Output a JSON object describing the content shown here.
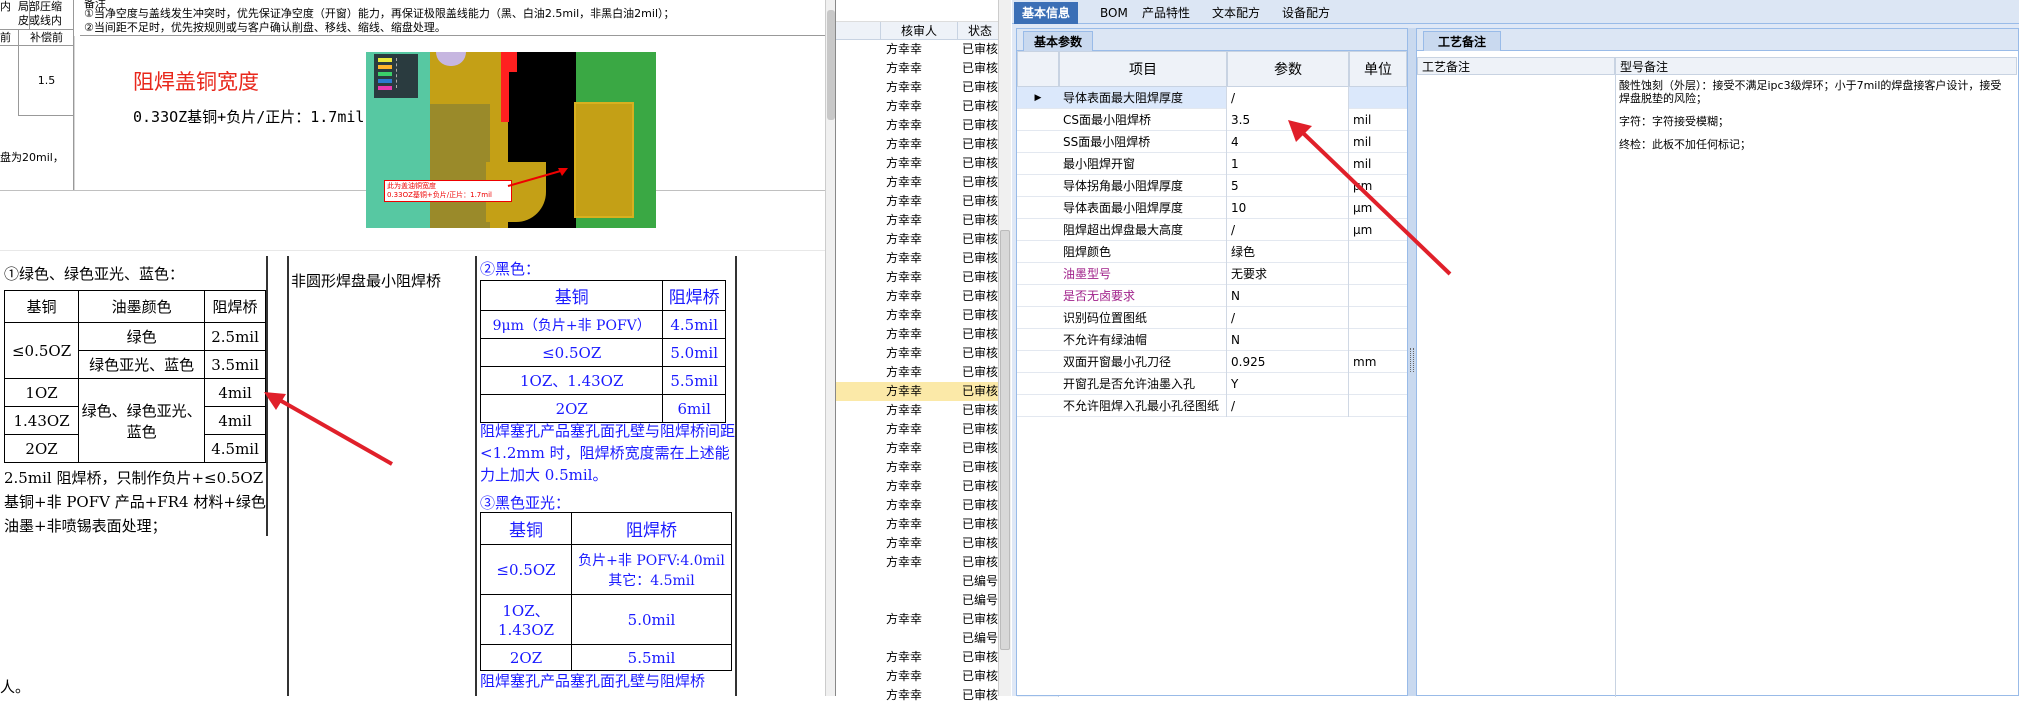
{
  "left_doc": {
    "top_cells": {
      "c1": "局部圧缩\n皮或线内",
      "c1b": "内",
      "c2": "前",
      "c3": "补偿前",
      "c4": "1.5",
      "c5": "盘为20mil，"
    },
    "top_note_lines": [
      "备注",
      "①当净空度与盖线发生冲突时，优先保证净空度（开窗）能力，再保证极限盖线能力（黑、白油2.5mil，非黑白油2mil）；",
      "②当间距不足时，优先按规则或与客户确认削盘、移线、缩线、缩盘处理。"
    ],
    "red_title": "阻焊盖铜宽度",
    "copper_line": "0.33OZ基铜+负片/正片：1.7mil",
    "img_caption_l1": "此为盖油铜宽度",
    "img_caption_l2": "0.33OZ基铜+负片/正片：1.7mil",
    "sec1_title": "①绿色、绿色亚光、蓝色：",
    "t1_header": [
      "基铜",
      "油墨颜色",
      "阻焊桥"
    ],
    "t1_rows": [
      [
        "≤0.5OZ",
        "绿色",
        "2.5mil"
      ],
      [
        "",
        "绿色亚光、蓝色",
        "3.5mil"
      ],
      [
        "1OZ",
        "绿色、绿色亚光、蓝色",
        "4mil"
      ],
      [
        "1.43OZ",
        "",
        "4mil"
      ],
      [
        "2OZ",
        "",
        "4.5mil"
      ]
    ],
    "t1_note": "2.5mil 阻焊桥，只制作负片+≤0.5OZ 基铜+非 POFV 产品+FR4 材料+绿色油墨+非喷锡表面处理；",
    "nonround": "非圆形焊盘最小阻焊桥",
    "sec2_title": "②黑色：",
    "t2_header": [
      "基铜",
      "阻焊桥"
    ],
    "t2_rows": [
      [
        "9μm（负片+非 POFV）",
        "4.5mil"
      ],
      [
        "≤0.5OZ",
        "5.0mil"
      ],
      [
        "1OZ、1.43OZ",
        "5.5mil"
      ],
      [
        "2OZ",
        "6mil"
      ]
    ],
    "plug_note": "阻焊塞孔产品塞孔面孔壁与阻焊桥间距<1.2mm 时，阻焊桥宽度需在上述能力上加大 0.5mil。",
    "sec3_title": "③黑色亚光：",
    "t3_header": [
      "基铜",
      "阻焊桥"
    ],
    "t3_rows": [
      [
        "≤0.5OZ",
        "负片+非 POFV:4.0mil 其它：4.5mil"
      ],
      [
        "1OZ、\n1.43OZ",
        "5.0mil"
      ],
      [
        "2OZ",
        "5.5mil"
      ]
    ],
    "plug_note2": "阻焊塞孔产品塞孔面孔壁与阻焊桥",
    "bottom_left": "人。"
  },
  "mid_list": {
    "headers": [
      "核审人",
      "状态"
    ],
    "rows": [
      [
        "方幸幸",
        "已审核"
      ],
      [
        "方幸幸",
        "已审核"
      ],
      [
        "方幸幸",
        "已审核"
      ],
      [
        "方幸幸",
        "已审核"
      ],
      [
        "方幸幸",
        "已审核"
      ],
      [
        "方幸幸",
        "已审核"
      ],
      [
        "方幸幸",
        "已审核"
      ],
      [
        "方幸幸",
        "已审核"
      ],
      [
        "方幸幸",
        "已审核"
      ],
      [
        "方幸幸",
        "已审核"
      ],
      [
        "方幸幸",
        "已审核"
      ],
      [
        "方幸幸",
        "已审核"
      ],
      [
        "方幸幸",
        "已审核"
      ],
      [
        "方幸幸",
        "已审核"
      ],
      [
        "方幸幸",
        "已审核"
      ],
      [
        "方幸幸",
        "已审核"
      ],
      [
        "方幸幸",
        "已审核"
      ],
      [
        "方幸幸",
        "已审核"
      ],
      [
        "方幸幸",
        "已审核"
      ],
      [
        "方幸幸",
        "已审核"
      ],
      [
        "方幸幸",
        "已审核"
      ],
      [
        "方幸幸",
        "已审核"
      ],
      [
        "方幸幸",
        "已审核"
      ],
      [
        "方幸幸",
        "已审核"
      ],
      [
        "方幸幸",
        "已审核"
      ],
      [
        "方幸幸",
        "已审核"
      ],
      [
        "方幸幸",
        "已审核"
      ],
      [
        "方幸幸",
        "已审核"
      ],
      [
        "",
        "已编号"
      ],
      [
        "",
        "已编号"
      ],
      [
        "方幸幸",
        "已审核"
      ],
      [
        "",
        "已编号"
      ],
      [
        "方幸幸",
        "已审核"
      ],
      [
        "方幸幸",
        "已审核"
      ],
      [
        "方幸幸",
        "已审核"
      ]
    ],
    "highlight_index": 18
  },
  "right": {
    "tabs": [
      "基本信息",
      "BOM",
      "产品特性",
      "文本配方",
      "设备配方"
    ],
    "sub_tab": "基本参数",
    "grid_headers": [
      "项目",
      "参数",
      "单位"
    ],
    "rows": [
      {
        "item": "导体表面最大阻焊厚度",
        "param": "/",
        "unit": "",
        "pink": false,
        "selected": true
      },
      {
        "item": "CS面最小阻焊桥",
        "param": "3.5",
        "unit": "mil",
        "pink": false
      },
      {
        "item": "SS面最小阻焊桥",
        "param": "4",
        "unit": "mil",
        "pink": false
      },
      {
        "item": "最小阻焊开窗",
        "param": "1",
        "unit": "mil",
        "pink": false
      },
      {
        "item": "导体拐角最小阻焊厚度",
        "param": "5",
        "unit": "μm",
        "pink": false
      },
      {
        "item": "导体表面最小阻焊厚度",
        "param": "10",
        "unit": "μm",
        "pink": false
      },
      {
        "item": "阻焊超出焊盘最大高度",
        "param": "/",
        "unit": "μm",
        "pink": false
      },
      {
        "item": "阻焊颜色",
        "param": "绿色",
        "unit": "",
        "pink": false
      },
      {
        "item": "油墨型号",
        "param": "无要求",
        "unit": "",
        "pink": true
      },
      {
        "item": "是否无卤要求",
        "param": "N",
        "unit": "",
        "pink": true
      },
      {
        "item": "识别码位置图纸",
        "param": "/",
        "unit": "",
        "pink": false
      },
      {
        "item": "不允许有绿油帽",
        "param": "N",
        "unit": "",
        "pink": false
      },
      {
        "item": "双面开窗最小孔刀径",
        "param": "0.925",
        "unit": "mm",
        "pink": false
      },
      {
        "item": "开窗孔是否允许油墨入孔",
        "param": "Y",
        "unit": "",
        "pink": false
      },
      {
        "item": "不允许阻焊入孔最小孔径图纸",
        "param": "/",
        "unit": "",
        "pink": false
      }
    ],
    "remark_tab": "工艺备注",
    "remark_headers": [
      "工艺备注",
      "型号备注"
    ],
    "remark_lines": [
      "酸性蚀刻（外层）：接受不满足ipc3级焊环；小于7mil的焊盘接客户设计，接受焊盘脱垫的风险；",
      "字符：字符接受模糊；",
      "终检：此板不加任何标记；"
    ]
  },
  "colors": {
    "accent": "#3b6fb6",
    "arrow": "#e0202a",
    "doc_blue": "#1a1aff",
    "red_title": "#e8271b"
  }
}
